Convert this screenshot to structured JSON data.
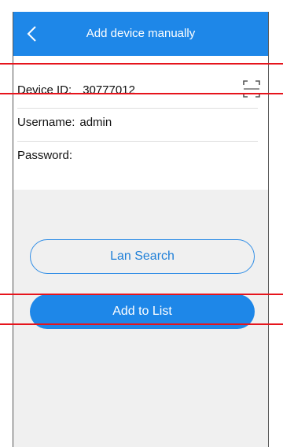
{
  "colors": {
    "accent": "#1e87e8",
    "background": "#f0f0f0",
    "highlight_line": "#e6141c"
  },
  "header": {
    "back_icon": "chevron-left-icon",
    "title": "Add device manually"
  },
  "form": {
    "device_id_label": "Device ID:",
    "device_id_value": "30777012",
    "scan_icon": "qr-scan-icon",
    "username_label": "Username:",
    "username_value": "admin",
    "password_label": "Password:",
    "password_value": ""
  },
  "buttons": {
    "lan_search": "Lan Search",
    "add_to_list": "Add to List"
  }
}
